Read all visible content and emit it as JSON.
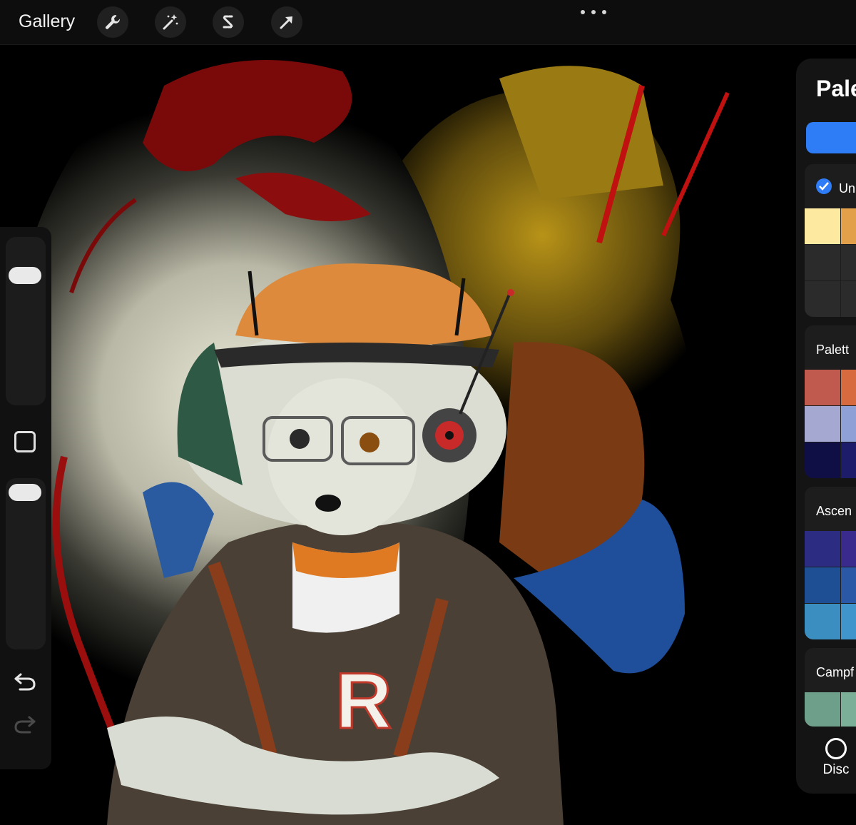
{
  "toolbar": {
    "gallery_label": "Gallery",
    "tools": [
      {
        "name": "actions",
        "icon": "wrench-icon"
      },
      {
        "name": "adjustments",
        "icon": "magic-wand-icon"
      },
      {
        "name": "selection",
        "icon": "selection-s-icon"
      },
      {
        "name": "transform",
        "icon": "arrow-cursor-icon"
      }
    ],
    "more_icon": "ellipsis-icon"
  },
  "sidebar": {
    "undo_icon": "undo-icon",
    "redo_icon": "redo-icon",
    "modify_icon": "square-icon"
  },
  "palette_panel": {
    "title": "Pale",
    "palettes": [
      {
        "name": "Un",
        "default": true,
        "colors": [
          "#fde9a0",
          "#e3a04a",
          "#2b2b2b",
          "#2b2b2b",
          "#2b2b2b",
          "#2b2b2b"
        ]
      },
      {
        "name": "Palett",
        "colors": [
          "#c05a4e",
          "#d76a3e",
          "#a5a9d2",
          "#8fa0d6",
          "#0f0f45",
          "#1c1c6b"
        ]
      },
      {
        "name": "Ascen",
        "colors": [
          "#2b2c82",
          "#3a2a8e",
          "#1e4f94",
          "#2a57a6",
          "#3a8ec0",
          "#3f95cc"
        ]
      },
      {
        "name": "Campf",
        "colors": [
          "#6e9f8a",
          "#7caf98"
        ]
      }
    ],
    "disc_label": "Disc"
  },
  "canvas": {
    "artwork_letter": "R"
  },
  "colors": {
    "accent": "#2f7df6",
    "toolbar_bg": "#0d0d0d",
    "panel_bg": "#141414"
  }
}
